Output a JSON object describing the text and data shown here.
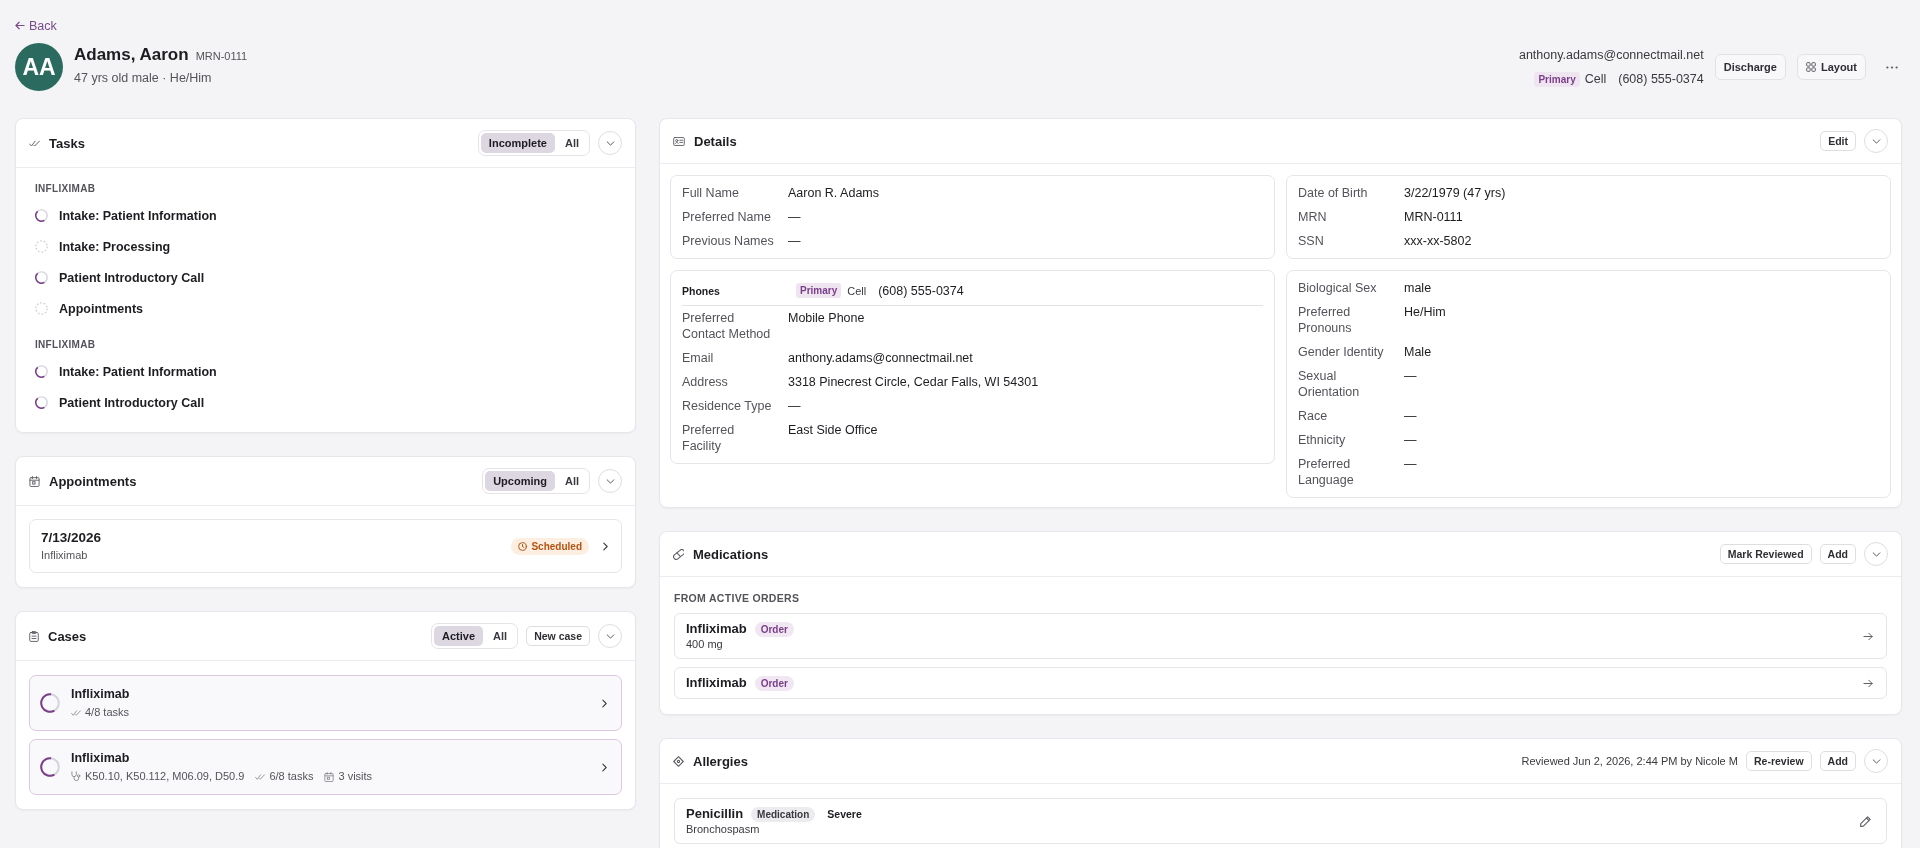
{
  "back_link": {
    "label": "Back"
  },
  "patient": {
    "initials": "AA",
    "name": "Adams, Aaron",
    "mrn": "MRN-0111",
    "summary": "47 yrs old male · He/Him",
    "email": "anthony.adams@connectmail.net",
    "phone": {
      "badge": "Primary",
      "type": "Cell",
      "number": "(608) 555-0374"
    }
  },
  "header_actions": [
    {
      "label": "Discharge",
      "kind": "plain"
    },
    {
      "label": "Layout",
      "kind": "grid"
    }
  ],
  "tasks": {
    "title": "Tasks",
    "filters": [
      {
        "label": "Incomplete",
        "selected": true
      },
      {
        "label": "All",
        "selected": false
      }
    ],
    "groups": [
      {
        "label": "INFLIXIMAB",
        "items": [
          {
            "label": "Intake: Patient Information",
            "kind": "in_progress"
          },
          {
            "label": "Intake: Processing",
            "kind": "not_started"
          },
          {
            "label": "Patient Introductory Call",
            "kind": "in_progress"
          },
          {
            "label": "Appointments",
            "kind": "not_started"
          }
        ]
      },
      {
        "label": "INFLIXIMAB",
        "items": [
          {
            "label": "Intake: Patient Information",
            "kind": "in_progress"
          },
          {
            "label": "Patient Introductory Call",
            "kind": "in_progress"
          }
        ]
      }
    ]
  },
  "appointments": {
    "title": "Appointments",
    "filters": [
      {
        "label": "Upcoming",
        "selected": true
      },
      {
        "label": "All",
        "selected": false
      }
    ],
    "items": [
      {
        "date": "7/13/2026",
        "case": "Infliximab",
        "status": {
          "label": "Scheduled",
          "kind": "scheduled"
        }
      }
    ]
  },
  "cases": {
    "title": "Cases",
    "filters": [
      {
        "label": "Active",
        "selected": true
      },
      {
        "label": "All",
        "selected": false
      }
    ],
    "new_button": "New case",
    "items": [
      {
        "name": "Infliximab",
        "meta": [
          {
            "kind": "tasks",
            "text": "4/8 tasks"
          }
        ]
      },
      {
        "name": "Infliximab",
        "meta": [
          {
            "kind": "diagnoses",
            "text": "K50.10, K50.112, M06.09, D50.9"
          },
          {
            "kind": "tasks",
            "text": "6/8 tasks"
          },
          {
            "kind": "visits",
            "text": "3 visits"
          }
        ]
      }
    ]
  },
  "details": {
    "title": "Details",
    "edit_button": "Edit",
    "sections": [
      {
        "rows": [
          {
            "label": "Full Name",
            "value": "Aaron R. Adams"
          },
          {
            "label": "Preferred Name",
            "value": "—"
          },
          {
            "label": "Previous Names",
            "value": "—"
          }
        ]
      },
      {
        "rows": [
          {
            "label": "Date of Birth",
            "value": "3/22/1979 (47 yrs)"
          },
          {
            "label": "MRN",
            "value": "MRN-0111"
          },
          {
            "label": "SSN",
            "value": "xxx-xx-5802"
          }
        ]
      },
      {
        "phones": {
          "label": "Phones",
          "badge": "Primary",
          "type": "Cell",
          "number": "(608) 555-0374"
        },
        "rows": [
          {
            "label": "Preferred Contact Method",
            "value": "Mobile Phone"
          },
          {
            "label": "Email",
            "value": "anthony.adams@connectmail.net"
          },
          {
            "label": "Address",
            "value": "3318 Pinecrest Circle, Cedar Falls, WI 54301"
          },
          {
            "label": "Residence Type",
            "value": "—"
          },
          {
            "label": "Preferred Facility",
            "value": "East Side Office"
          }
        ]
      },
      {
        "rows": [
          {
            "label": "Biological Sex",
            "value": "male"
          },
          {
            "label": "Preferred Pronouns",
            "value": "He/Him"
          },
          {
            "label": "Gender Identity",
            "value": "Male"
          },
          {
            "label": "Sexual Orientation",
            "value": "—"
          },
          {
            "label": "Race",
            "value": "—"
          },
          {
            "label": "Ethnicity",
            "value": "—"
          },
          {
            "label": "Preferred Language",
            "value": "—"
          }
        ]
      }
    ]
  },
  "medications": {
    "title": "Medications",
    "actions": [
      {
        "label": "Mark Reviewed"
      },
      {
        "label": "Add"
      }
    ],
    "group_label": "FROM ACTIVE ORDERS",
    "items": [
      {
        "name": "Infliximab",
        "tag": "Order",
        "dose": "400 mg"
      },
      {
        "name": "Infliximab",
        "tag": "Order"
      }
    ]
  },
  "allergies": {
    "title": "Allergies",
    "review_note": "Reviewed Jun 2, 2026, 2:44 PM by Nicole M",
    "actions": [
      {
        "label": "Re-review"
      },
      {
        "label": "Add"
      }
    ],
    "items": [
      {
        "name": "Penicillin",
        "type": "Medication",
        "severity": "Severe",
        "reaction": "Bronchospasm"
      }
    ]
  }
}
